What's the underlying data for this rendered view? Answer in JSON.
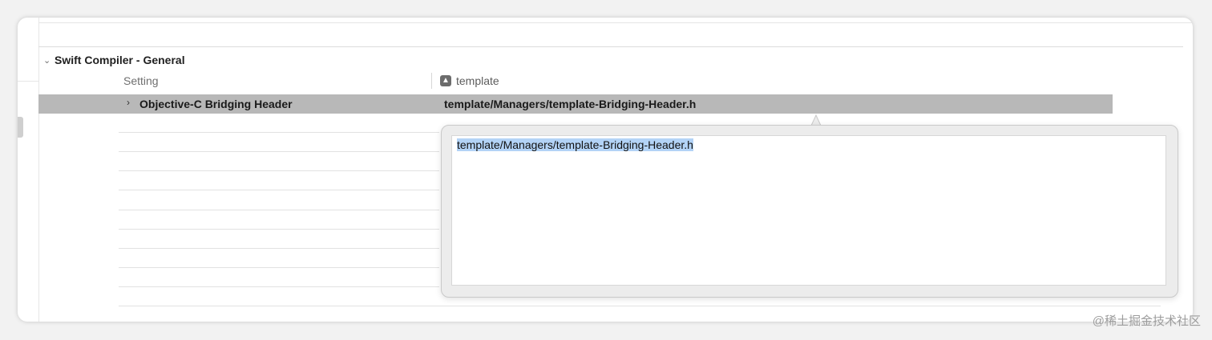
{
  "section": {
    "title": "Swift Compiler - General"
  },
  "columns": {
    "setting": "Setting",
    "target": "template"
  },
  "selected_row": {
    "setting": "Objective-C Bridging Header",
    "value": "template/Managers/template-Bridging-Header.h"
  },
  "popover": {
    "text": "template/Managers/template-Bridging-Header.h"
  },
  "watermark": "@稀土掘金技术社区",
  "colors": {
    "selected_row_bg": "#b8b8b8",
    "text_selection": "#b3d3f6"
  },
  "icons": {
    "section_toggle": "chevron-down-icon",
    "row_toggle": "chevron-right-icon",
    "target": "app-target-icon"
  }
}
